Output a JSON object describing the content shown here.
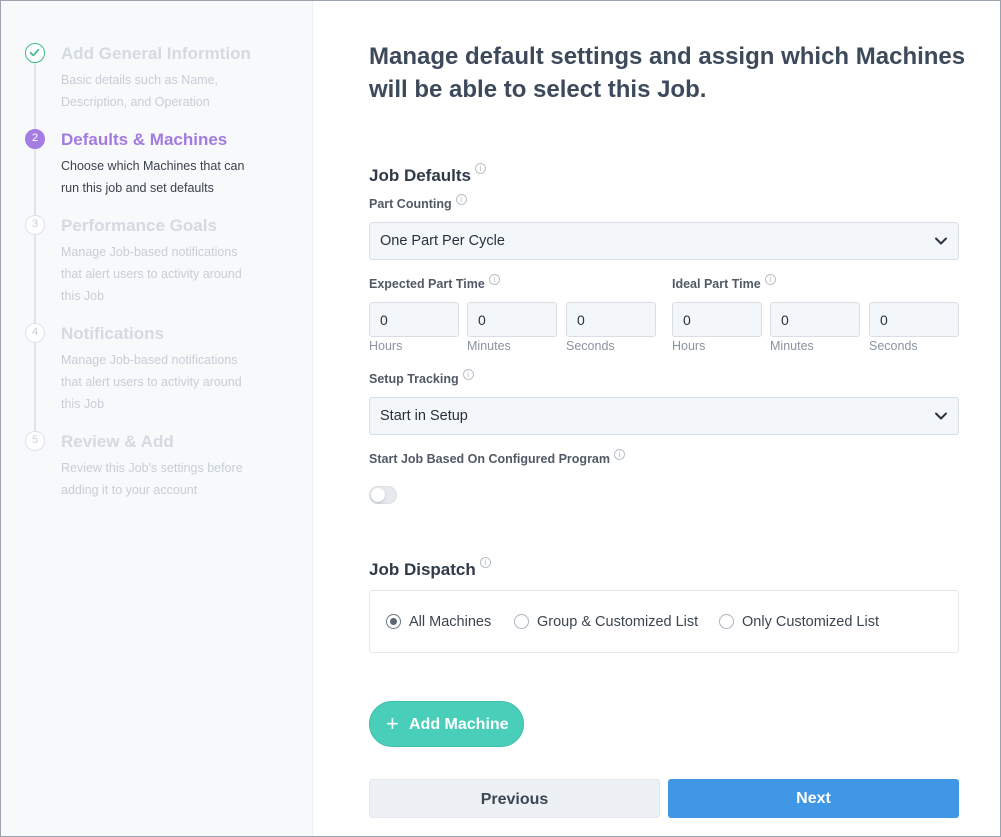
{
  "sidebar": {
    "steps": [
      {
        "number": "1",
        "title": "Add General Informtion",
        "desc": "Basic details such as Name, Description, and Operation",
        "state": "done"
      },
      {
        "number": "2",
        "title": "Defaults & Machines",
        "desc": "Choose which Machines that can run this job and set defaults",
        "state": "active"
      },
      {
        "number": "3",
        "title": "Performance Goals",
        "desc": "Manage Job-based notifications that alert users to activity around this Job",
        "state": "pending"
      },
      {
        "number": "4",
        "title": "Notifications",
        "desc": "Manage Job-based notifications that alert users to activity around this Job",
        "state": "pending"
      },
      {
        "number": "5",
        "title": "Review & Add",
        "desc": "Review this Job's settings before adding it to your account",
        "state": "pending"
      }
    ]
  },
  "main": {
    "heading": "Manage default settings and assign which Machines will be able to select this Job.",
    "job_defaults": {
      "title": "Job Defaults",
      "part_counting": {
        "label": "Part Counting",
        "value": "One Part Per Cycle"
      },
      "expected_part_time": {
        "label": "Expected Part Time",
        "hours": "0",
        "minutes": "0",
        "seconds": "0"
      },
      "ideal_part_time": {
        "label": "Ideal Part Time",
        "hours": "0",
        "minutes": "0",
        "seconds": "0"
      },
      "units": {
        "hours": "Hours",
        "minutes": "Minutes",
        "seconds": "Seconds"
      },
      "setup_tracking": {
        "label": "Setup Tracking",
        "value": "Start in Setup"
      },
      "start_job_program": {
        "label": "Start Job Based On Configured Program",
        "enabled": false
      }
    },
    "job_dispatch": {
      "title": "Job Dispatch",
      "options": [
        "All Machines",
        "Group & Customized List",
        "Only Customized List"
      ],
      "selected": "All Machines"
    },
    "add_machine_label": "Add Machine",
    "previous_label": "Previous",
    "next_label": "Next"
  },
  "colors": {
    "accent_purple": "#a37be0",
    "success_green": "#3fb98b",
    "teal_button": "#49cfb9",
    "primary_blue": "#3f97e6"
  },
  "icons": {
    "step1": "check-circle-icon",
    "info": "info-icon",
    "select": "chevron-down-icon",
    "add": "plus-icon"
  }
}
